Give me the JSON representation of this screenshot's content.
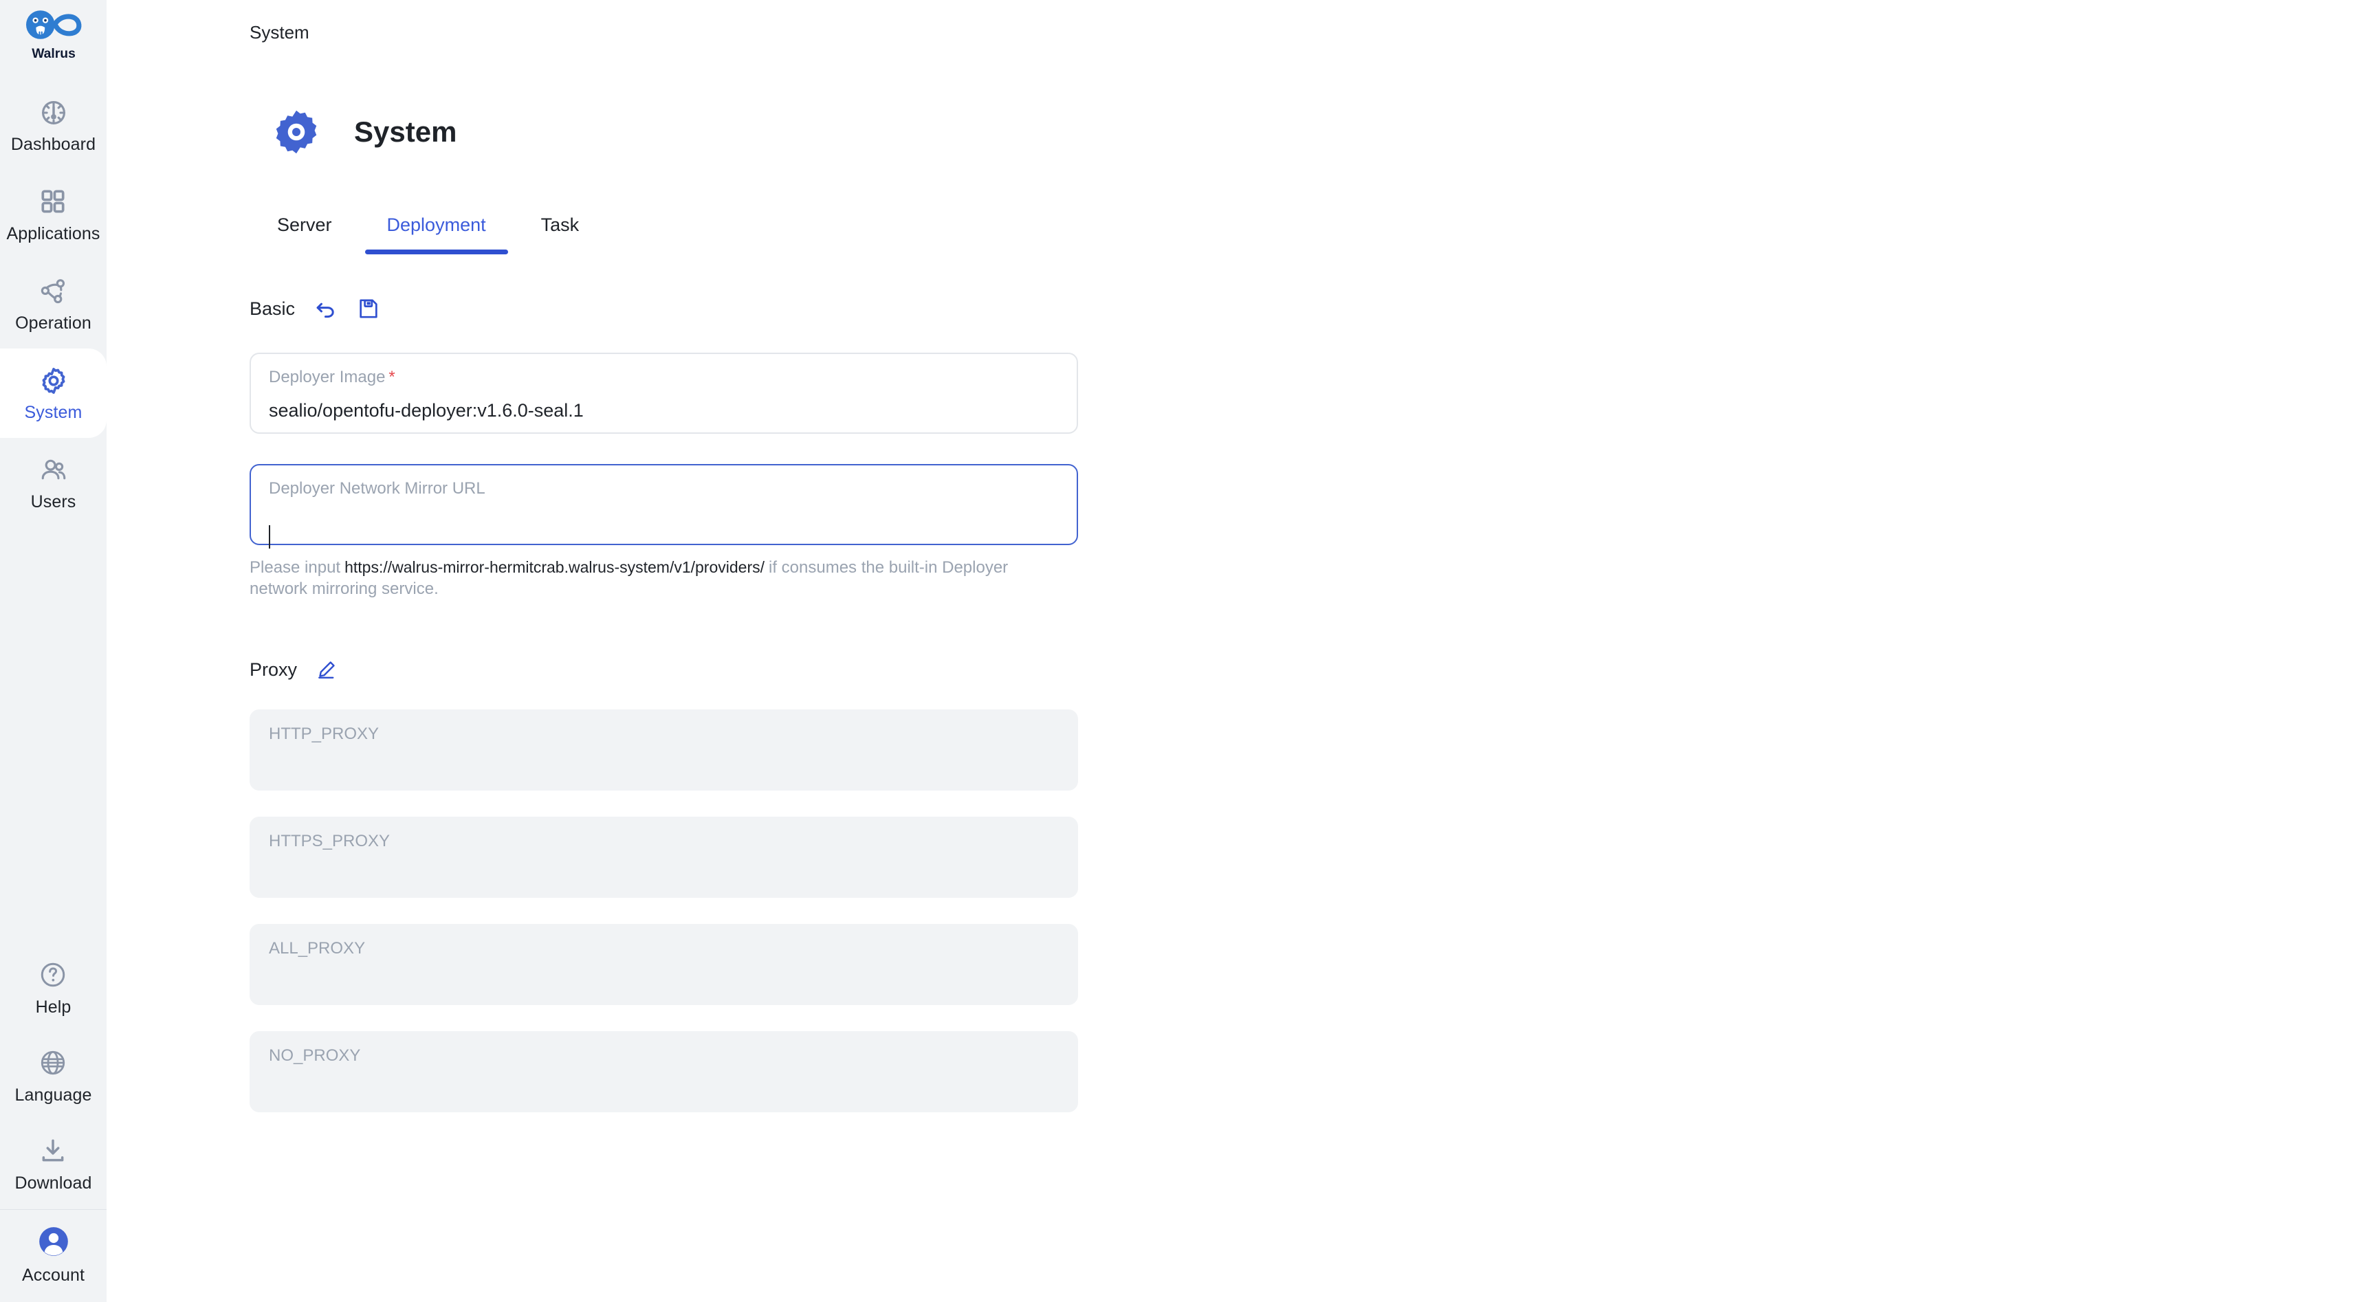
{
  "brand": {
    "name": "Walrus",
    "logo_icon": "walrus-infinity-logo"
  },
  "sidebar": {
    "top_items": [
      {
        "label": "Dashboard",
        "icon": "speedometer-icon",
        "active": false
      },
      {
        "label": "Applications",
        "icon": "grid-squares-icon",
        "active": false
      },
      {
        "label": "Operation",
        "icon": "nodes-network-icon",
        "active": false
      },
      {
        "label": "System",
        "icon": "gear-icon",
        "active": true
      },
      {
        "label": "Users",
        "icon": "users-icon",
        "active": false
      }
    ],
    "bottom_items": [
      {
        "label": "Help",
        "icon": "question-circle-icon"
      },
      {
        "label": "Language",
        "icon": "globe-icon"
      },
      {
        "label": "Download",
        "icon": "download-icon"
      },
      {
        "label": "Account",
        "icon": "account-avatar-icon"
      }
    ]
  },
  "breadcrumb": "System",
  "page": {
    "title": "System",
    "icon": "gear-icon"
  },
  "tabs": [
    {
      "label": "Server",
      "active": false
    },
    {
      "label": "Deployment",
      "active": true
    },
    {
      "label": "Task",
      "active": false
    }
  ],
  "basic": {
    "title": "Basic",
    "undo_icon": "undo-arrow-icon",
    "save_icon": "save-floppy-icon",
    "deployer_image": {
      "label": "Deployer Image",
      "required_marker": "*",
      "value": "sealio/opentofu-deployer:v1.6.0-seal.1"
    },
    "mirror_url": {
      "label": "Deployer Network Mirror URL",
      "value": "",
      "focused": true,
      "helper_prefix": "Please input",
      "helper_url": "https://walrus-mirror-hermitcrab.walrus-system/v1/providers/",
      "helper_suffix": "if consumes the built-in Deployer network mirroring service."
    }
  },
  "proxy": {
    "title": "Proxy",
    "edit_icon": "pencil-edit-icon",
    "fields": [
      {
        "label": "HTTP_PROXY",
        "value": "",
        "disabled": true
      },
      {
        "label": "HTTPS_PROXY",
        "value": "",
        "disabled": true
      },
      {
        "label": "ALL_PROXY",
        "value": "",
        "disabled": true
      },
      {
        "label": "NO_PROXY",
        "value": "",
        "disabled": true
      }
    ]
  },
  "colors": {
    "accent": "#3b5bdb",
    "accent_dark": "#2f4fd0",
    "sidebar_bg": "#f1f3f5",
    "text": "#1f2329",
    "muted": "#9aa3b0",
    "required": "#e5484d",
    "disabled_bg": "#f1f3f5"
  }
}
